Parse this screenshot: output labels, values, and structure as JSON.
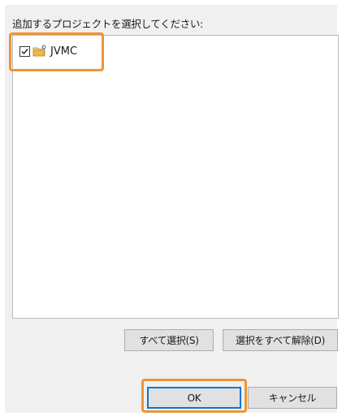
{
  "dialog": {
    "prompt": "追加するプロジェクトを選択してください:",
    "projects": [
      {
        "label": "JVMC",
        "checked": true,
        "icon": "project-folder-icon"
      }
    ],
    "select_all_label": "すべて選択(S)",
    "deselect_all_label": "選択をすべて解除(D)",
    "ok_label": "OK",
    "cancel_label": "キャンセル"
  },
  "colors": {
    "highlight": "#ee9433",
    "ok_focus": "#0078d7",
    "dialog_bg": "#f0f0f0"
  }
}
